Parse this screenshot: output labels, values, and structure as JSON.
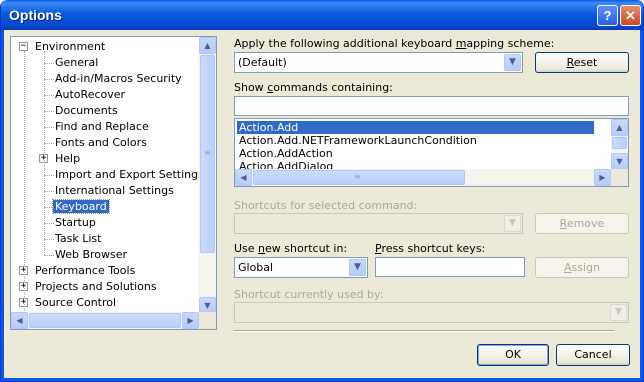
{
  "window": {
    "title": "Options",
    "help_glyph": "?",
    "close_glyph": "✕"
  },
  "tree": {
    "items": [
      {
        "label": "Environment",
        "expander": "−"
      },
      {
        "label": "General"
      },
      {
        "label": "Add-in/Macros Security"
      },
      {
        "label": "AutoRecover"
      },
      {
        "label": "Documents"
      },
      {
        "label": "Find and Replace"
      },
      {
        "label": "Fonts and Colors"
      },
      {
        "label": "Help",
        "expander": "+"
      },
      {
        "label": "Import and Export Settings"
      },
      {
        "label": "International Settings"
      },
      {
        "label": "Keyboard",
        "selected": true
      },
      {
        "label": "Startup"
      },
      {
        "label": "Task List"
      },
      {
        "label": "Web Browser"
      },
      {
        "label": "Performance Tools",
        "expander": "+"
      },
      {
        "label": "Projects and Solutions",
        "expander": "+"
      },
      {
        "label": "Source Control",
        "expander": "+"
      }
    ]
  },
  "keyboard": {
    "mapping_label_pre": "Apply the following additional keyboard ",
    "mapping_label_u": "m",
    "mapping_label_post": "apping scheme:",
    "mapping_value": "(Default)",
    "reset_pre": "",
    "reset_u": "R",
    "reset_post": "eset",
    "show_label_pre": "Show ",
    "show_label_u": "c",
    "show_label_post": "ommands containing:",
    "search_value": "",
    "commands": [
      "Action.Add",
      "Action.Add.NETFrameworkLaunchCondition",
      "Action.AddAction",
      "Action.AddDialog"
    ],
    "shortcuts_selected_label": "Shortcuts for selected command:",
    "remove_pre": "",
    "remove_u": "R",
    "remove_post": "emove",
    "use_label_pre": "Use ",
    "use_label_u": "n",
    "use_label_post": "ew shortcut in:",
    "use_value": "Global",
    "press_label_pre": "",
    "press_label_u": "P",
    "press_label_post": "ress shortcut keys:",
    "press_value": "",
    "assign_pre": "",
    "assign_u": "A",
    "assign_post": "ssign",
    "currently_label": "Shortcut currently used by:",
    "ok_label": "OK",
    "cancel_label": "Cancel"
  },
  "icons": {
    "arrow_up": "▲",
    "arrow_down": "▼",
    "arrow_left": "◀",
    "arrow_right": "▶",
    "grip": "≡"
  },
  "colors": {
    "title_blue": "#0b5ade",
    "selection": "#316ac5",
    "dialog_bg": "#ece9d8"
  }
}
